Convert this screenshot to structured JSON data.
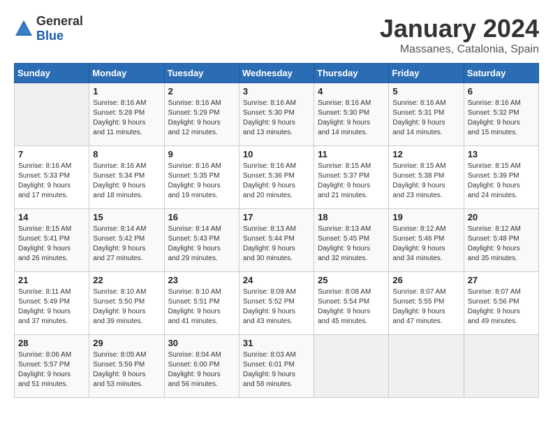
{
  "logo": {
    "general": "General",
    "blue": "Blue"
  },
  "title": "January 2024",
  "location": "Massanes, Catalonia, Spain",
  "days_of_week": [
    "Sunday",
    "Monday",
    "Tuesday",
    "Wednesday",
    "Thursday",
    "Friday",
    "Saturday"
  ],
  "weeks": [
    [
      {
        "day": "",
        "info": ""
      },
      {
        "day": "1",
        "info": "Sunrise: 8:16 AM\nSunset: 5:28 PM\nDaylight: 9 hours\nand 11 minutes."
      },
      {
        "day": "2",
        "info": "Sunrise: 8:16 AM\nSunset: 5:29 PM\nDaylight: 9 hours\nand 12 minutes."
      },
      {
        "day": "3",
        "info": "Sunrise: 8:16 AM\nSunset: 5:30 PM\nDaylight: 9 hours\nand 13 minutes."
      },
      {
        "day": "4",
        "info": "Sunrise: 8:16 AM\nSunset: 5:30 PM\nDaylight: 9 hours\nand 14 minutes."
      },
      {
        "day": "5",
        "info": "Sunrise: 8:16 AM\nSunset: 5:31 PM\nDaylight: 9 hours\nand 14 minutes."
      },
      {
        "day": "6",
        "info": "Sunrise: 8:16 AM\nSunset: 5:32 PM\nDaylight: 9 hours\nand 15 minutes."
      }
    ],
    [
      {
        "day": "7",
        "info": "Sunrise: 8:16 AM\nSunset: 5:33 PM\nDaylight: 9 hours\nand 17 minutes."
      },
      {
        "day": "8",
        "info": "Sunrise: 8:16 AM\nSunset: 5:34 PM\nDaylight: 9 hours\nand 18 minutes."
      },
      {
        "day": "9",
        "info": "Sunrise: 8:16 AM\nSunset: 5:35 PM\nDaylight: 9 hours\nand 19 minutes."
      },
      {
        "day": "10",
        "info": "Sunrise: 8:16 AM\nSunset: 5:36 PM\nDaylight: 9 hours\nand 20 minutes."
      },
      {
        "day": "11",
        "info": "Sunrise: 8:15 AM\nSunset: 5:37 PM\nDaylight: 9 hours\nand 21 minutes."
      },
      {
        "day": "12",
        "info": "Sunrise: 8:15 AM\nSunset: 5:38 PM\nDaylight: 9 hours\nand 23 minutes."
      },
      {
        "day": "13",
        "info": "Sunrise: 8:15 AM\nSunset: 5:39 PM\nDaylight: 9 hours\nand 24 minutes."
      }
    ],
    [
      {
        "day": "14",
        "info": "Sunrise: 8:15 AM\nSunset: 5:41 PM\nDaylight: 9 hours\nand 26 minutes."
      },
      {
        "day": "15",
        "info": "Sunrise: 8:14 AM\nSunset: 5:42 PM\nDaylight: 9 hours\nand 27 minutes."
      },
      {
        "day": "16",
        "info": "Sunrise: 8:14 AM\nSunset: 5:43 PM\nDaylight: 9 hours\nand 29 minutes."
      },
      {
        "day": "17",
        "info": "Sunrise: 8:13 AM\nSunset: 5:44 PM\nDaylight: 9 hours\nand 30 minutes."
      },
      {
        "day": "18",
        "info": "Sunrise: 8:13 AM\nSunset: 5:45 PM\nDaylight: 9 hours\nand 32 minutes."
      },
      {
        "day": "19",
        "info": "Sunrise: 8:12 AM\nSunset: 5:46 PM\nDaylight: 9 hours\nand 34 minutes."
      },
      {
        "day": "20",
        "info": "Sunrise: 8:12 AM\nSunset: 5:48 PM\nDaylight: 9 hours\nand 35 minutes."
      }
    ],
    [
      {
        "day": "21",
        "info": "Sunrise: 8:11 AM\nSunset: 5:49 PM\nDaylight: 9 hours\nand 37 minutes."
      },
      {
        "day": "22",
        "info": "Sunrise: 8:10 AM\nSunset: 5:50 PM\nDaylight: 9 hours\nand 39 minutes."
      },
      {
        "day": "23",
        "info": "Sunrise: 8:10 AM\nSunset: 5:51 PM\nDaylight: 9 hours\nand 41 minutes."
      },
      {
        "day": "24",
        "info": "Sunrise: 8:09 AM\nSunset: 5:52 PM\nDaylight: 9 hours\nand 43 minutes."
      },
      {
        "day": "25",
        "info": "Sunrise: 8:08 AM\nSunset: 5:54 PM\nDaylight: 9 hours\nand 45 minutes."
      },
      {
        "day": "26",
        "info": "Sunrise: 8:07 AM\nSunset: 5:55 PM\nDaylight: 9 hours\nand 47 minutes."
      },
      {
        "day": "27",
        "info": "Sunrise: 8:07 AM\nSunset: 5:56 PM\nDaylight: 9 hours\nand 49 minutes."
      }
    ],
    [
      {
        "day": "28",
        "info": "Sunrise: 8:06 AM\nSunset: 5:57 PM\nDaylight: 9 hours\nand 51 minutes."
      },
      {
        "day": "29",
        "info": "Sunrise: 8:05 AM\nSunset: 5:59 PM\nDaylight: 9 hours\nand 53 minutes."
      },
      {
        "day": "30",
        "info": "Sunrise: 8:04 AM\nSunset: 6:00 PM\nDaylight: 9 hours\nand 56 minutes."
      },
      {
        "day": "31",
        "info": "Sunrise: 8:03 AM\nSunset: 6:01 PM\nDaylight: 9 hours\nand 58 minutes."
      },
      {
        "day": "",
        "info": ""
      },
      {
        "day": "",
        "info": ""
      },
      {
        "day": "",
        "info": ""
      }
    ]
  ]
}
